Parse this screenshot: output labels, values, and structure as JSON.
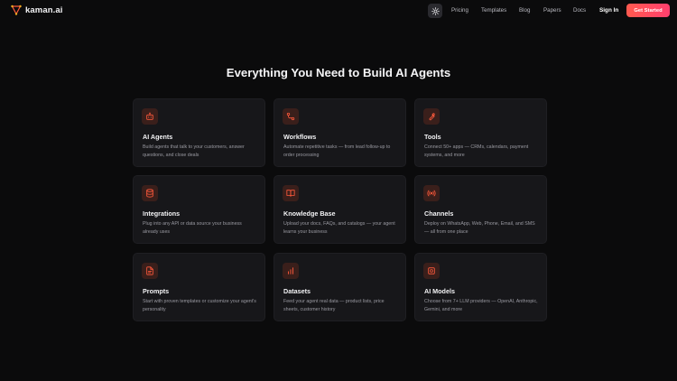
{
  "brand": {
    "name": "kaman.ai",
    "accent": "#ff5a3c"
  },
  "nav": {
    "theme_icon": "sun-icon",
    "links": [
      "Pricing",
      "Templates",
      "Blog",
      "Papers",
      "Docs"
    ],
    "sign_in": "Sign In",
    "cta": "Get Started"
  },
  "main": {
    "title": "Everything You Need to Build AI Agents",
    "cards": [
      {
        "icon": "bot-icon",
        "title": "AI Agents",
        "desc": "Build agents that talk to your customers, answer questions, and close deals"
      },
      {
        "icon": "workflow-icon",
        "title": "Workflows",
        "desc": "Automate repetitive tasks — from lead follow-up to order processing"
      },
      {
        "icon": "wrench-icon",
        "title": "Tools",
        "desc": "Connect 50+ apps — CRMs, calendars, payment systems, and more"
      },
      {
        "icon": "database-icon",
        "title": "Integrations",
        "desc": "Plug into any API or data source your business already uses"
      },
      {
        "icon": "book-open-icon",
        "title": "Knowledge Base",
        "desc": "Upload your docs, FAQs, and catalogs — your agent learns your business"
      },
      {
        "icon": "radio-icon",
        "title": "Channels",
        "desc": "Deploy on WhatsApp, Web, Phone, Email, and SMS — all from one place"
      },
      {
        "icon": "file-text-icon",
        "title": "Prompts",
        "desc": "Start with proven templates or customize your agent's personality"
      },
      {
        "icon": "bar-chart-icon",
        "title": "Datasets",
        "desc": "Feed your agent real data — product lists, price sheets, customer history"
      },
      {
        "icon": "cpu-icon",
        "title": "AI Models",
        "desc": "Choose from 7+ LLM providers — OpenAI, Anthropic, Gemini, and more"
      }
    ]
  }
}
